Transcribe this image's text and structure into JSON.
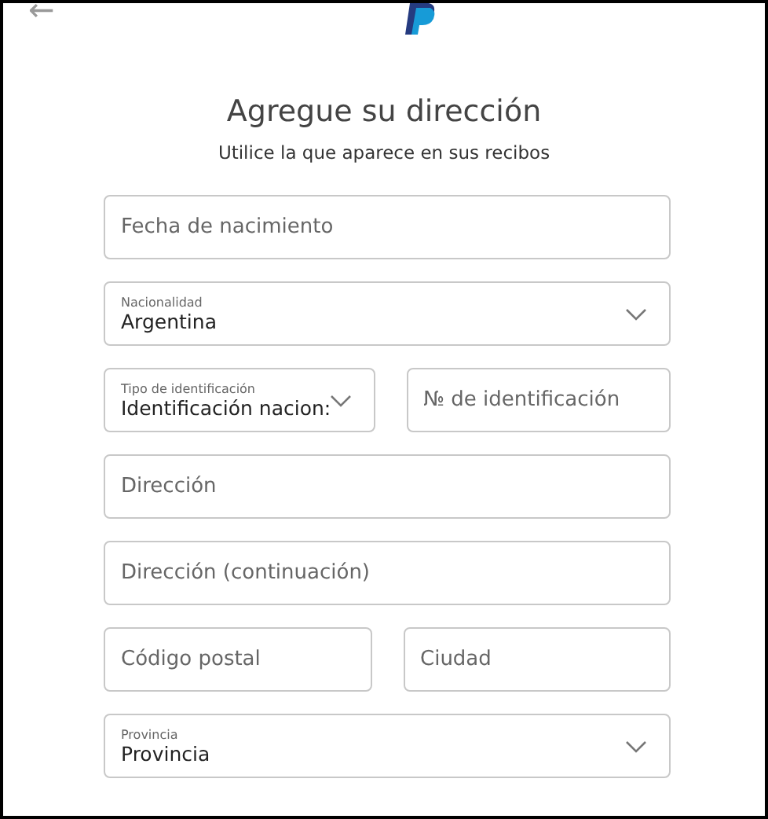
{
  "header": {
    "back": "←"
  },
  "title": "Agregue su dirección",
  "subtitle": "Utilice la que aparece en sus recibos",
  "rows": [
    [
      {
        "kind": "text",
        "placeholder": "Fecha de nacimiento"
      }
    ],
    [
      {
        "kind": "select",
        "label": "Nacionalidad",
        "value": "Argentina"
      }
    ],
    [
      {
        "kind": "select",
        "label": "Tipo de identificación",
        "value": "Identificación nacion:"
      },
      {
        "kind": "text",
        "placeholder": "№ de identificación"
      }
    ],
    [
      {
        "kind": "text",
        "placeholder": "Dirección"
      }
    ],
    [
      {
        "kind": "text",
        "placeholder": "Dirección (continuación)"
      }
    ],
    [
      {
        "kind": "text",
        "placeholder": "Código postal"
      },
      {
        "kind": "text",
        "placeholder": "Ciudad"
      }
    ],
    [
      {
        "kind": "select",
        "label": "Provincia",
        "value": "Provincia"
      }
    ]
  ]
}
